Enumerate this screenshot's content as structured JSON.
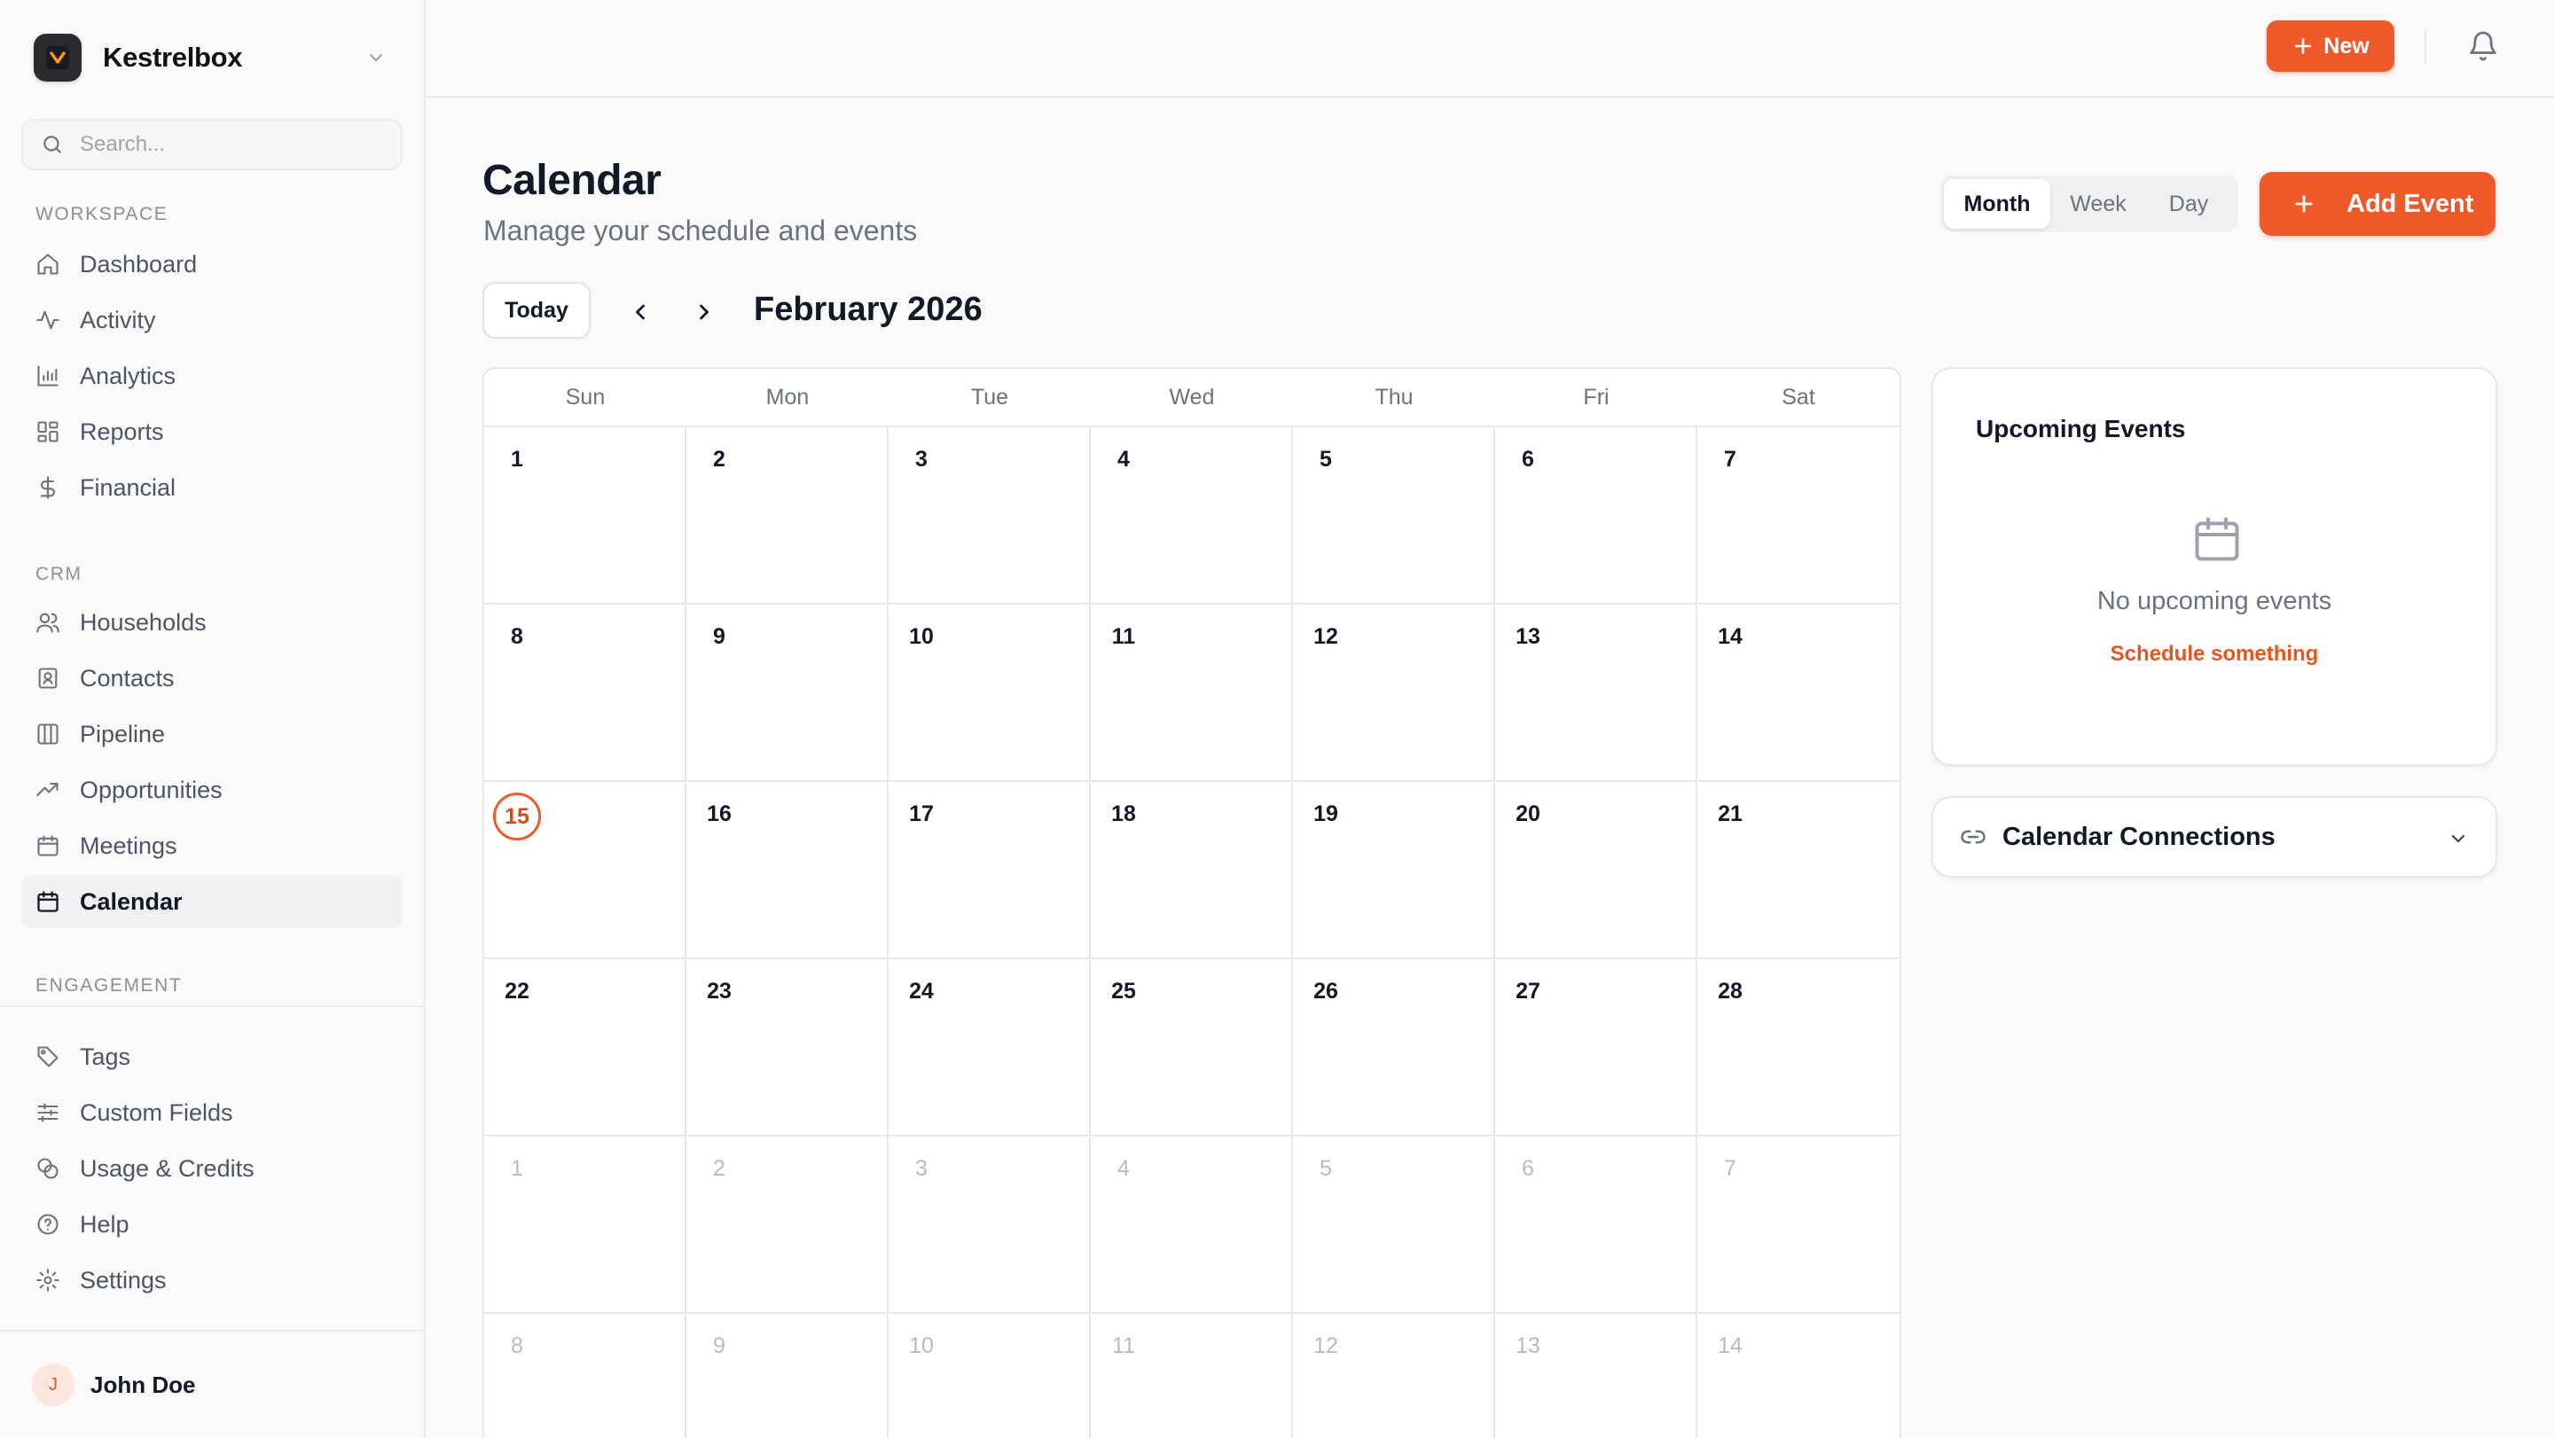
{
  "brand": {
    "name": "Kestrelbox"
  },
  "search": {
    "placeholder": "Search..."
  },
  "sidebar": {
    "workspace_label": "WORKSPACE",
    "workspace_items": [
      {
        "label": "Dashboard",
        "icon": "home-icon"
      },
      {
        "label": "Activity",
        "icon": "activity-icon"
      },
      {
        "label": "Analytics",
        "icon": "bar-chart-icon"
      },
      {
        "label": "Reports",
        "icon": "grid-icon"
      },
      {
        "label": "Financial",
        "icon": "dollar-icon"
      }
    ],
    "crm_label": "CRM",
    "crm_items": [
      {
        "label": "Households",
        "icon": "users-icon"
      },
      {
        "label": "Contacts",
        "icon": "contact-card-icon"
      },
      {
        "label": "Pipeline",
        "icon": "columns-icon"
      },
      {
        "label": "Opportunities",
        "icon": "trending-up-icon"
      },
      {
        "label": "Meetings",
        "icon": "calendar-icon"
      },
      {
        "label": "Calendar",
        "icon": "calendar-icon",
        "active": true
      }
    ],
    "engagement_label": "ENGAGEMENT",
    "engagement_items": [
      {
        "label": "Tags",
        "icon": "tag-icon"
      },
      {
        "label": "Custom Fields",
        "icon": "sliders-icon"
      },
      {
        "label": "Usage & Credits",
        "icon": "coins-icon"
      },
      {
        "label": "Help",
        "icon": "help-circle-icon"
      },
      {
        "label": "Settings",
        "icon": "gear-icon"
      }
    ],
    "user": {
      "initial": "J",
      "name": "John Doe"
    }
  },
  "topbar": {
    "new_label": "New"
  },
  "page": {
    "title": "Calendar",
    "subtitle": "Manage your schedule and events",
    "views": [
      "Month",
      "Week",
      "Day"
    ],
    "active_view": "Month",
    "add_event_label": "Add Event",
    "today_label": "Today",
    "month_label": "February 2026"
  },
  "calendar": {
    "weekdays": [
      "Sun",
      "Mon",
      "Tue",
      "Wed",
      "Thu",
      "Fri",
      "Sat"
    ],
    "weeks": [
      [
        "1",
        "2",
        "3",
        "4",
        "5",
        "6",
        "7"
      ],
      [
        "8",
        "9",
        "10",
        "11",
        "12",
        "13",
        "14"
      ],
      [
        "15",
        "16",
        "17",
        "18",
        "19",
        "20",
        "21"
      ],
      [
        "22",
        "23",
        "24",
        "25",
        "26",
        "27",
        "28"
      ],
      [
        "1",
        "2",
        "3",
        "4",
        "5",
        "6",
        "7"
      ],
      [
        "8",
        "9",
        "10",
        "11",
        "12",
        "13",
        "14"
      ]
    ],
    "other_month_weeks": [
      4,
      5
    ],
    "today": "15"
  },
  "upcoming": {
    "title": "Upcoming Events",
    "empty_text": "No upcoming events",
    "link_label": "Schedule something"
  },
  "connections": {
    "label": "Calendar Connections"
  },
  "colors": {
    "accent": "#ef5a2a",
    "accent_text": "#e8551f"
  }
}
